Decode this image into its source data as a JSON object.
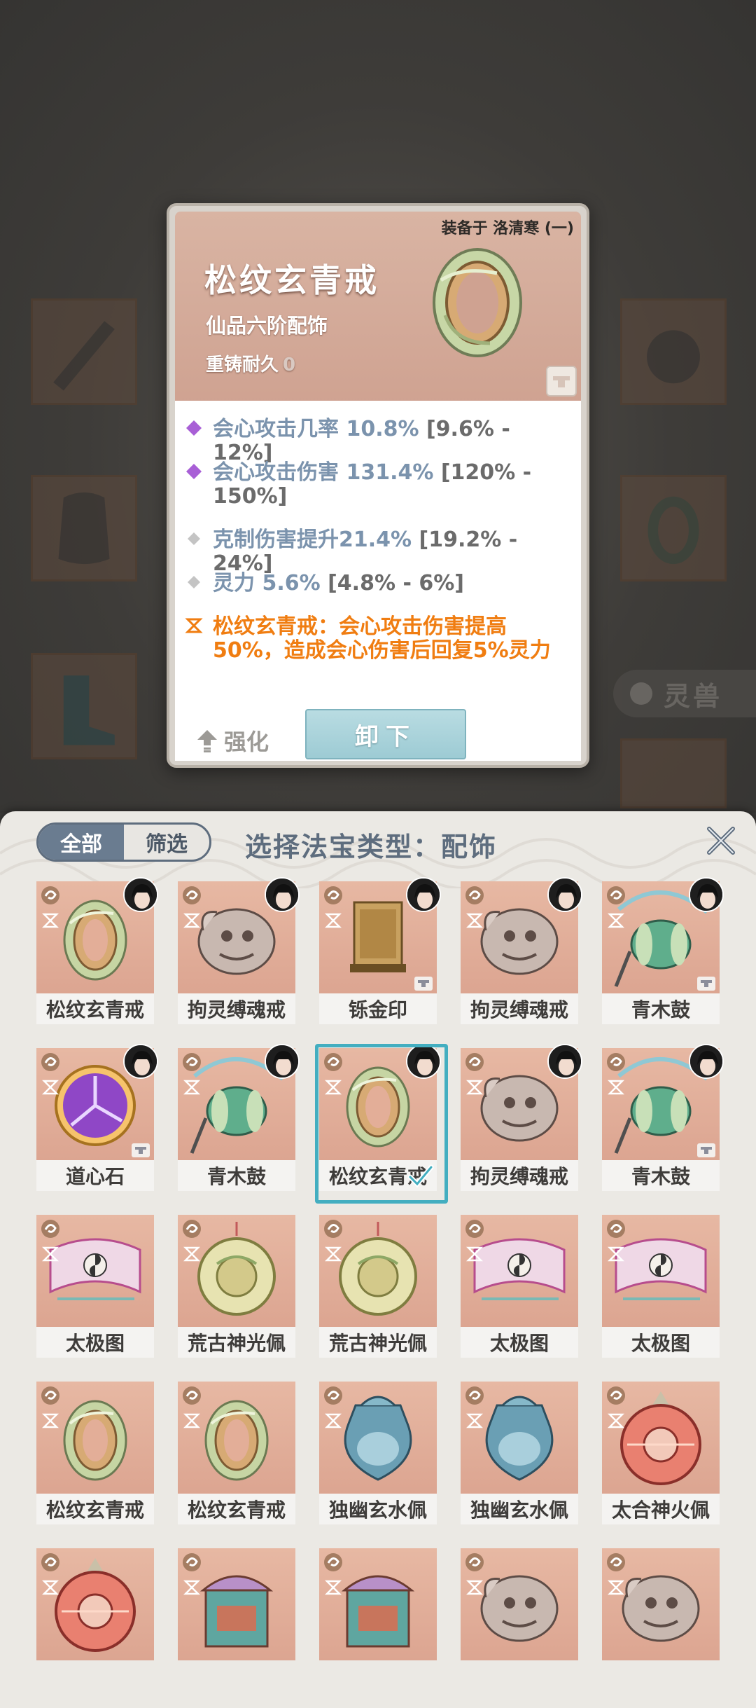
{
  "popup": {
    "equipped_on": "装备于 洛清寒 (一)",
    "item_name": "松纹玄青戒",
    "item_grade": "仙品六阶配饰",
    "reforge_label": "重铸耐久",
    "reforge_value": "0",
    "stats": [
      {
        "kind": "purple",
        "main": "会心攻击几率 10.8%",
        "range": " [9.6% - 12%]"
      },
      {
        "kind": "purple",
        "main": "会心攻击伤害 131.4%",
        "range": " [120% - 150%]"
      },
      {
        "kind": "gray",
        "main": "克制伤害提升21.4%",
        "range": " [19.2% - 24%]"
      },
      {
        "kind": "gray",
        "main": "灵力 5.6%",
        "range": " [4.8% - 6%]"
      }
    ],
    "set_effect": "松纹玄青戒：会心攻击伤害提高50%，造成会心伤害后回复5%灵力",
    "enhance_label": "强化",
    "unequip_label": "卸下"
  },
  "background": {
    "spirit_tab_label": "灵兽"
  },
  "panel": {
    "tabs": [
      {
        "label": "全部",
        "active": true
      },
      {
        "label": "筛选",
        "active": false
      }
    ],
    "title": "选择法宝类型：配饰",
    "close_icon": "close-icon"
  },
  "items": [
    {
      "name": "松纹玄青戒",
      "art": "ring",
      "has_char": true,
      "selected": false
    },
    {
      "name": "拘灵缚魂戒",
      "art": "beast",
      "has_char": true,
      "selected": false
    },
    {
      "name": "铄金印",
      "art": "seal",
      "has_char": true,
      "locked": true,
      "selected": false
    },
    {
      "name": "拘灵缚魂戒",
      "art": "beast",
      "has_char": true,
      "selected": false
    },
    {
      "name": "青木鼓",
      "art": "drum",
      "has_char": true,
      "locked": true,
      "selected": false
    },
    {
      "name": "道心石",
      "art": "orb",
      "has_char": true,
      "locked": true,
      "selected": false
    },
    {
      "name": "青木鼓",
      "art": "drum",
      "has_char": true,
      "selected": false
    },
    {
      "name": "松纹玄青戒",
      "art": "ring",
      "has_char": true,
      "selected": true
    },
    {
      "name": "拘灵缚魂戒",
      "art": "beast",
      "has_char": true,
      "selected": false
    },
    {
      "name": "青木鼓",
      "art": "drum",
      "has_char": true,
      "locked": true,
      "selected": false
    },
    {
      "name": "太极图",
      "art": "scroll",
      "has_char": false,
      "selected": false
    },
    {
      "name": "荒古神光佩",
      "art": "pendant",
      "has_char": false,
      "selected": false
    },
    {
      "name": "荒古神光佩",
      "art": "pendant",
      "has_char": false,
      "selected": false
    },
    {
      "name": "太极图",
      "art": "scroll",
      "has_char": false,
      "selected": false
    },
    {
      "name": "太极图",
      "art": "scroll",
      "has_char": false,
      "selected": false
    },
    {
      "name": "松纹玄青戒",
      "art": "ring",
      "has_char": false,
      "selected": false
    },
    {
      "name": "松纹玄青戒",
      "art": "ring",
      "has_char": false,
      "selected": false
    },
    {
      "name": "独幽玄水佩",
      "art": "vase",
      "has_char": false,
      "selected": false
    },
    {
      "name": "独幽玄水佩",
      "art": "vase",
      "has_char": false,
      "selected": false
    },
    {
      "name": "太合神火佩",
      "art": "firepen",
      "has_char": false,
      "selected": false
    },
    {
      "name": "",
      "art": "firepen",
      "has_char": false,
      "selected": false
    },
    {
      "name": "",
      "art": "tower",
      "has_char": false,
      "selected": false
    },
    {
      "name": "",
      "art": "tower",
      "has_char": false,
      "selected": false
    },
    {
      "name": "",
      "art": "beast",
      "has_char": false,
      "selected": false
    },
    {
      "name": "",
      "art": "beast",
      "has_char": false,
      "selected": false
    }
  ],
  "colors": {
    "accent_teal": "#43aec0",
    "stat_blue": "#7b93ad",
    "set_orange": "#f07d11",
    "diamond_purple": "#a85fd6"
  }
}
